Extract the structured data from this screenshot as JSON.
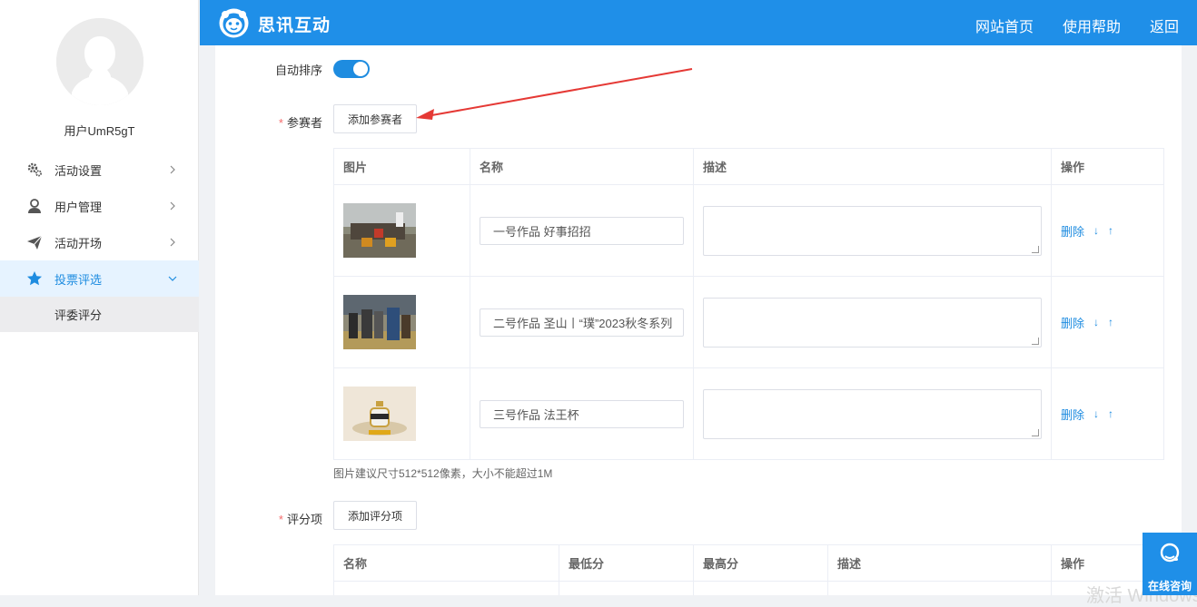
{
  "sidebar": {
    "username": "用户UmR5gT",
    "items": [
      {
        "label": "活动设置",
        "icon": "gear-icon"
      },
      {
        "label": "用户管理",
        "icon": "user-icon"
      },
      {
        "label": "活动开场",
        "icon": "paper-plane-icon"
      },
      {
        "label": "投票评选",
        "icon": "star-icon",
        "active": true
      }
    ],
    "sub_item": "评委评分"
  },
  "topbar": {
    "brand": "思讯互动",
    "links": [
      "网站首页",
      "使用帮助",
      "返回"
    ]
  },
  "form": {
    "auto_sort_label": "自动排序",
    "auto_sort_on": true,
    "participants_label": "参赛者",
    "add_participant_button": "添加参赛者",
    "participants_table": {
      "headers": [
        "图片",
        "名称",
        "描述",
        "操作"
      ],
      "rows": [
        {
          "name": "一号作品  好事招招",
          "description": "",
          "delete": "删除",
          "down": "↓",
          "up": "↑"
        },
        {
          "name": "二号作品  圣山丨“璞”2023秋冬系列",
          "description": "",
          "delete": "删除",
          "down": "↓",
          "up": "↑"
        },
        {
          "name": "三号作品  法王杯",
          "description": "",
          "delete": "删除",
          "down": "↓",
          "up": "↑"
        }
      ]
    },
    "image_hint": "图片建议尺寸512*512像素，大小不能超过1M",
    "score_items_label": "评分项",
    "add_score_button": "添加评分项",
    "score_table": {
      "headers": [
        "名称",
        "最低分",
        "最高分",
        "描述",
        "操作"
      ]
    }
  },
  "chat_widget": {
    "label": "在线咨询"
  },
  "watermark": "激活 Windows",
  "colors": {
    "primary": "#1f8fe8",
    "accent": "#1e8ce0",
    "required": "#f56c6c",
    "arrow": "#e53935"
  }
}
